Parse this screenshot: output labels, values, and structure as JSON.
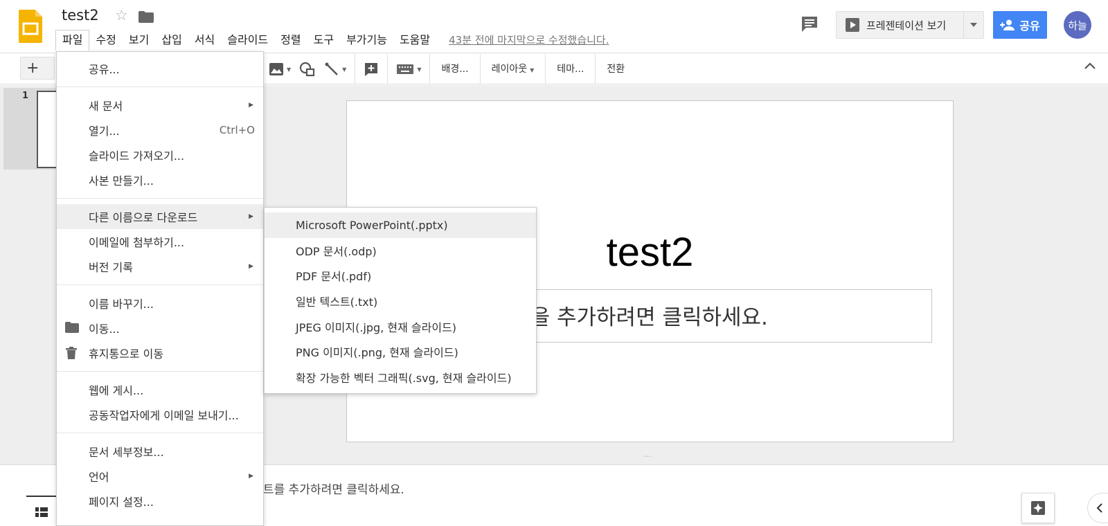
{
  "header": {
    "title": "test2",
    "last_edit": "43분 전에 마지막으로 수정했습니다.",
    "present_label": "프레젠테이션 보기",
    "share_label": "공유",
    "avatar_label": "하늘",
    "brand_color": "#f4b400",
    "share_color": "#4285f4"
  },
  "menubar": {
    "items": [
      "파일",
      "수정",
      "보기",
      "삽입",
      "서식",
      "슬라이드",
      "정렬",
      "도구",
      "부가기능",
      "도움말"
    ]
  },
  "toolbar": {
    "add_label": "+",
    "background": "배경...",
    "layout": "레이아웃",
    "theme": "테마...",
    "transition": "전환"
  },
  "filmstrip": {
    "slide_number": "1"
  },
  "slide": {
    "title": "test2",
    "subtitle": "목을 추가하려면 클릭하세요."
  },
  "notes": {
    "placeholder": "트를 추가하려면 클릭하세요."
  },
  "file_menu": {
    "share": "공유...",
    "new_doc": "새 문서",
    "open": "열기...",
    "open_shortcut": "Ctrl+O",
    "import_slides": "슬라이드 가져오기...",
    "make_copy": "사본 만들기...",
    "download_as": "다른 이름으로 다운로드",
    "email_attach": "이메일에 첨부하기...",
    "version_history": "버전 기록",
    "rename": "이름 바꾸기...",
    "move": "이동...",
    "trash": "휴지통으로 이동",
    "publish": "웹에 게시...",
    "email_collab": "공동작업자에게 이메일 보내기...",
    "doc_details": "문서 세부정보...",
    "language": "언어",
    "page_setup": "페이지 설정..."
  },
  "download_menu": {
    "items": [
      "Microsoft PowerPoint(.pptx)",
      "ODP 문서(.odp)",
      "PDF 문서(.pdf)",
      "일반 텍스트(.txt)",
      "JPEG 이미지(.jpg, 현재 슬라이드)",
      "PNG 이미지(.png, 현재 슬라이드)",
      "확장 가능한 벡터 그래픽(.svg, 현재 슬라이드)"
    ]
  }
}
